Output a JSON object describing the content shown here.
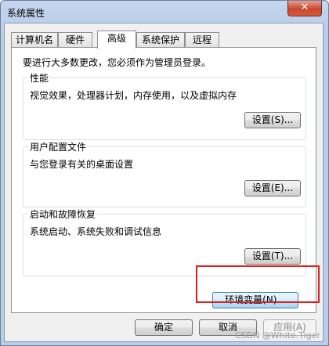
{
  "window": {
    "title": "系统属性",
    "close_label": "✕"
  },
  "tabs": [
    {
      "label": "计算机名"
    },
    {
      "label": "硬件"
    },
    {
      "label": "高级"
    },
    {
      "label": "系统保护"
    },
    {
      "label": "远程"
    }
  ],
  "active_tab": "高级",
  "intro": "要进行大多数更改，您必须作为管理员登录。",
  "groups": {
    "performance": {
      "title": "性能",
      "desc": "视觉效果，处理器计划，内存使用，以及虚拟内存",
      "button": "设置(S)..."
    },
    "profiles": {
      "title": "用户配置文件",
      "desc": "与您登录有关的桌面设置",
      "button": "设置(E)..."
    },
    "startup": {
      "title": "启动和故障恢复",
      "desc": "系统启动、系统失败和调试信息",
      "button": "设置(T)..."
    }
  },
  "env_button": "环境变量(N)...",
  "footer": {
    "ok": "确定",
    "cancel": "取消",
    "apply": "应用(A)"
  },
  "watermark": "CSDN @White.Tiger",
  "colors": {
    "highlight": "#e0201c",
    "close": "#c9472f"
  }
}
